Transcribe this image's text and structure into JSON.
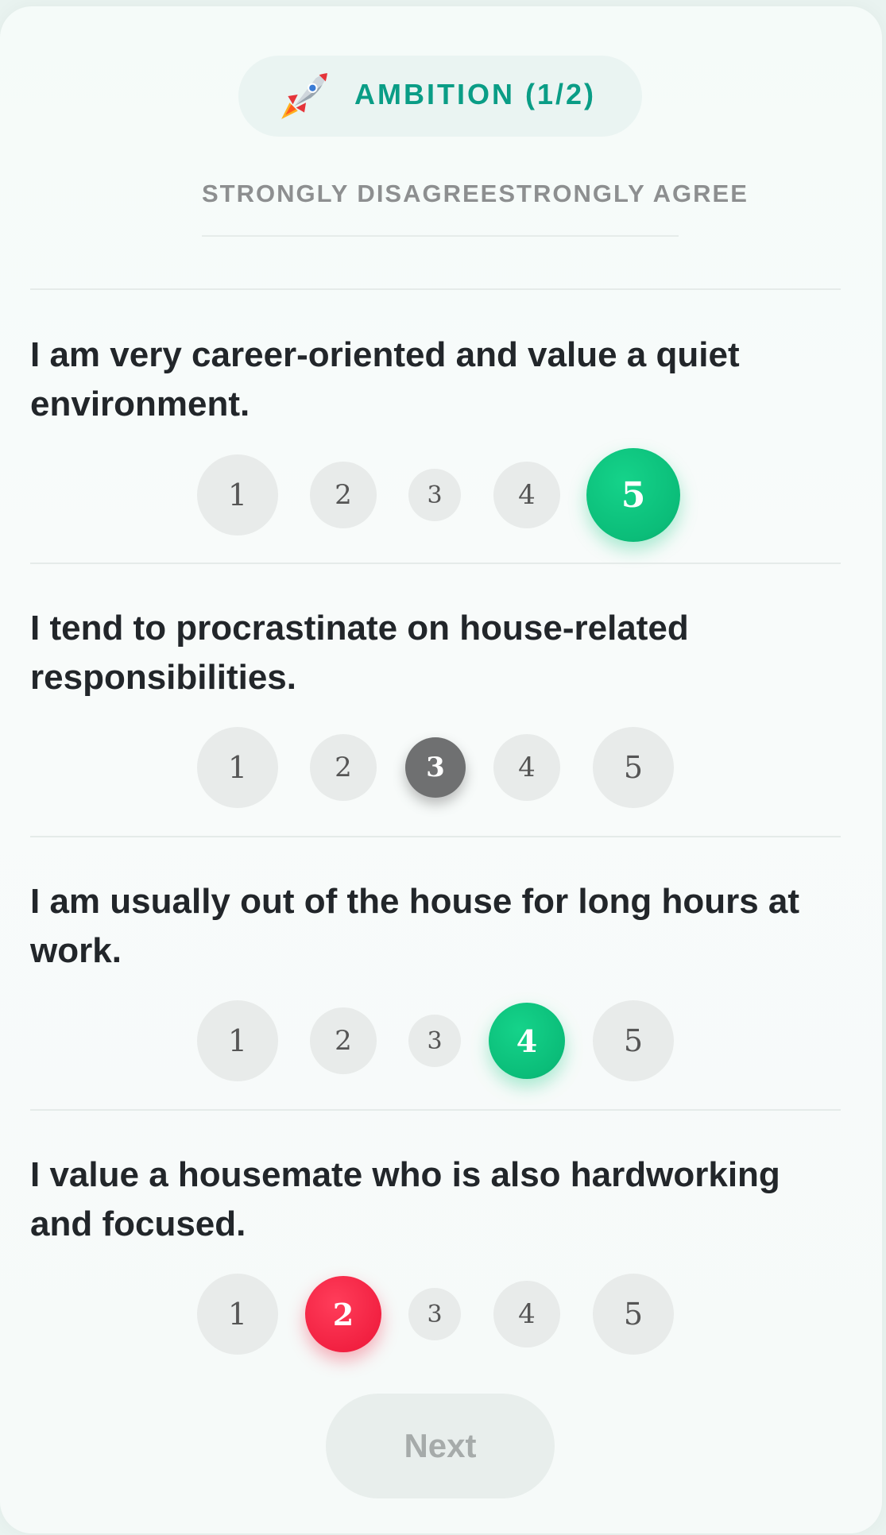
{
  "badge": {
    "icon": "rocket-icon",
    "label": "AMBITION (1/2)"
  },
  "scale": {
    "left_label": "STRONGLY DISAGREE",
    "right_label": "STRONGLY AGREE"
  },
  "questions": [
    {
      "text": "I am very career-oriented and value a quiet environment.",
      "options": [
        "1",
        "2",
        "3",
        "4",
        "5"
      ],
      "selected": "5",
      "selected_color": "#0bbd79"
    },
    {
      "text": "I tend to procrastinate on house-related responsibilities.",
      "options": [
        "1",
        "2",
        "3",
        "4",
        "5"
      ],
      "selected": "3",
      "selected_color": "#6f7071"
    },
    {
      "text": "I am usually out of the house for long hours at work.",
      "options": [
        "1",
        "2",
        "3",
        "4",
        "5"
      ],
      "selected": "4",
      "selected_color": "#0bbd79"
    },
    {
      "text": "I value a housemate who is also hardworking and focused.",
      "options": [
        "1",
        "2",
        "3",
        "4",
        "5"
      ],
      "selected": "2",
      "selected_color": "#f01d3e"
    }
  ],
  "next_button": {
    "label": "Next",
    "enabled": false
  },
  "colors": {
    "accent": "#0a9d86",
    "agree": "#0bbd79",
    "neutral": "#6f7071",
    "disagree": "#f01d3e"
  }
}
